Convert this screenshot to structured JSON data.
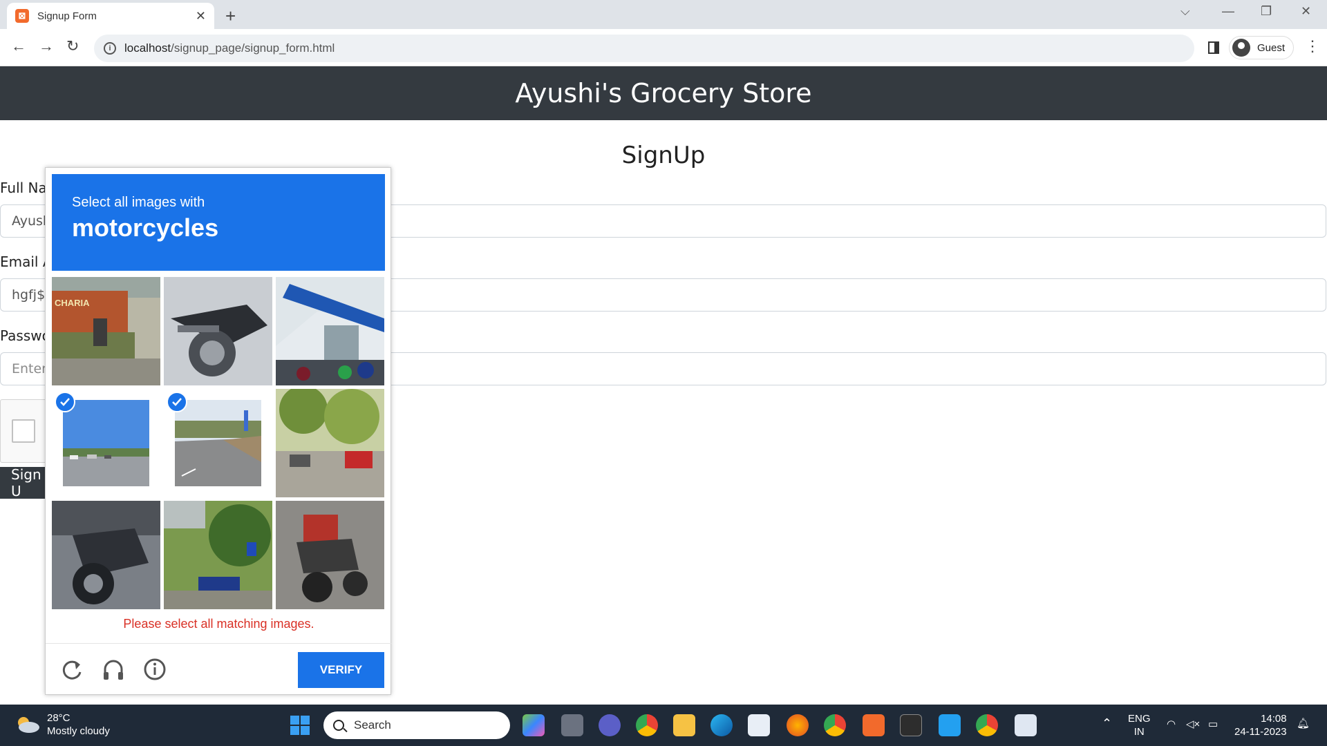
{
  "browser": {
    "tab_title": "Signup Form",
    "url_host": "localhost",
    "url_path": "/signup_page/signup_form.html",
    "profile": "Guest"
  },
  "page": {
    "header": "Ayushi's Grocery Store",
    "title": "SignUp",
    "fields": [
      {
        "label": "Full Na",
        "value": "Ayush"
      },
      {
        "label": "Email A",
        "value": "hgfj$g"
      },
      {
        "label": "Passwo",
        "placeholder": "Enter"
      }
    ],
    "signup_button": "Sign U"
  },
  "captcha": {
    "instruction": "Select all images with",
    "target": "motorcycles",
    "tiles": [
      {
        "label": "CHARIA",
        "selected": false
      },
      {
        "label": "",
        "selected": false
      },
      {
        "label": "",
        "selected": false
      },
      {
        "label": "",
        "selected": true
      },
      {
        "label": "",
        "selected": true
      },
      {
        "label": "",
        "selected": false
      },
      {
        "label": "",
        "selected": false
      },
      {
        "label": "",
        "selected": false
      },
      {
        "label": "",
        "selected": false
      }
    ],
    "error": "Please select all matching images.",
    "verify_label": "VERIFY",
    "accent": "#1a73e8"
  },
  "taskbar": {
    "temperature": "28°C",
    "weather": "Mostly cloudy",
    "search": "Search",
    "lang1": "ENG",
    "lang2": "IN",
    "time": "14:08",
    "date": "24-11-2023"
  }
}
